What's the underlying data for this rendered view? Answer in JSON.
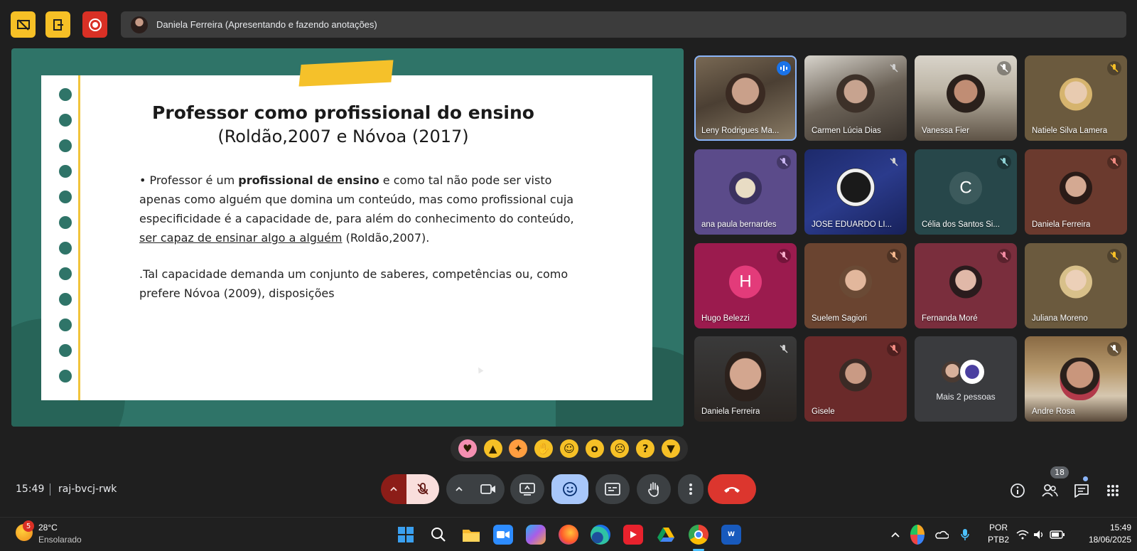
{
  "top_bar": {
    "presenter_label": "Daniela Ferreira (Apresentando e fazendo anotações)"
  },
  "slide": {
    "title": "Professor como profissional do ensino",
    "subtitle": "(Roldão,2007 e Nóvoa (2017)",
    "p1_a": "• Professor é um ",
    "p1_b": "profissional de ensino",
    "p1_c": " e como tal não pode ser visto apenas como alguém que domina um conteúdo, mas como profissional cuja especificidade é a capacidade de, para além do conhecimento do conteúdo, ",
    "p1_d": "ser capaz de ensinar algo a alguém",
    "p1_e": " (Roldão,2007).",
    "p2": ".Tal capacidade demanda um conjunto de saberes, competências ou, como prefere Nóvoa (2009), disposições"
  },
  "participants": [
    {
      "name": "Leny Rodrigues Ma...",
      "state": "speaking"
    },
    {
      "name": "Carmen Lúcia Dias",
      "state": "muted"
    },
    {
      "name": "Vanessa Fier",
      "state": "muted"
    },
    {
      "name": "Natiele Silva Lamera",
      "state": "muted"
    },
    {
      "name": "ana paula bernardes",
      "state": "muted"
    },
    {
      "name": "JOSÉ EDUARDO LI...",
      "state": "muted"
    },
    {
      "name": "Célia dos Santos Si...",
      "state": "muted",
      "letter": "C"
    },
    {
      "name": "Daniela Ferreira",
      "state": "muted"
    },
    {
      "name": "Hugo Belezzi",
      "state": "muted",
      "letter": "H"
    },
    {
      "name": "Suelem Sagiori",
      "state": "muted"
    },
    {
      "name": "Fernanda Moré",
      "state": "muted"
    },
    {
      "name": "Juliana Moreno",
      "state": "muted"
    },
    {
      "name": "Daniela Ferreira",
      "state": "muted"
    },
    {
      "name": "Gisele",
      "state": "muted"
    },
    {
      "name": "Mais 2 pessoas",
      "state": "overflow"
    },
    {
      "name": "Andre Rosa",
      "state": "muted"
    }
  ],
  "reactions": [
    "sparkling-heart",
    "thumbs-up",
    "party-popper",
    "clapping-hands",
    "tears-of-joy",
    "surprised-face",
    "sad-face",
    "thinking-face",
    "thumbs-down"
  ],
  "meeting": {
    "time": "15:49",
    "code": "raj-bvcj-rwk",
    "participant_count": "18"
  },
  "taskbar": {
    "weather_badge": "5",
    "weather_temp": "28°C",
    "weather_desc": "Ensolarado",
    "lang_1": "POR",
    "lang_2": "PTB2",
    "time": "15:49",
    "date": "18/06/2025",
    "apps": [
      "start",
      "search",
      "file-explorer",
      "zoom",
      "copilot",
      "firefox",
      "edge",
      "globoplay",
      "google-drive",
      "chrome",
      "word"
    ]
  },
  "colors": {
    "slide_bg": "#2f7468",
    "accent_yellow": "#f6c026",
    "record_red": "#d93025",
    "end_call_red": "#dc362e",
    "emoji_active_blue": "#a8c7fa"
  }
}
